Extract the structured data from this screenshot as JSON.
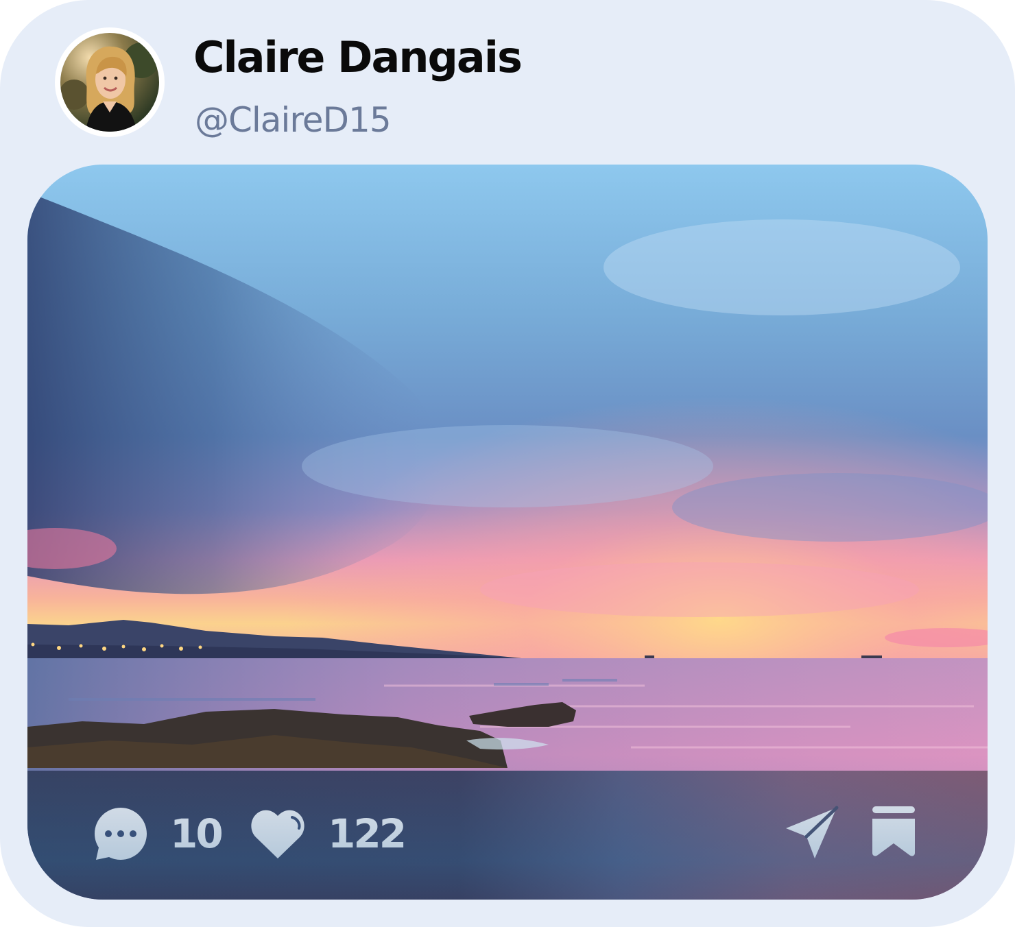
{
  "post": {
    "author_name": "Claire Dangais",
    "author_handle": "@ClaireD15",
    "image_subject": "sunset over the sea",
    "stats": {
      "comments": "10",
      "likes": "122"
    }
  },
  "icons": {
    "comment": "comment-bubble-icon",
    "like": "heart-icon",
    "share": "send-icon",
    "bookmark": "bookmark-icon"
  },
  "colors": {
    "card_background": "#e6edf8",
    "name_text": "#0a0a0a",
    "handle_text": "#6b7a99",
    "action_icon": "#e4e7ee"
  }
}
